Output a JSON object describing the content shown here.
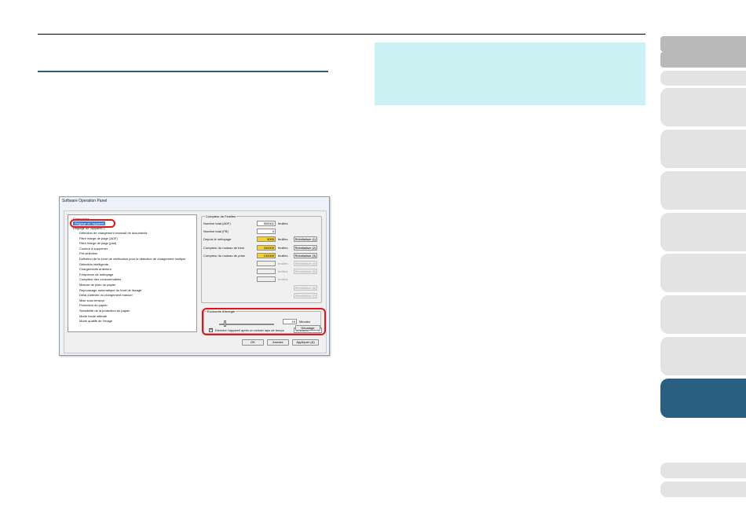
{
  "window": {
    "title": "Software Operation Panel"
  },
  "tree": {
    "items": [
      "Diagnostics",
      "Réglage de l'appareil",
      "Réglage de l'appareil 2",
      "Détection de chargement excessif de documents",
      "Filtre marge de page (ADF)",
      "Filtre marge de page (plat)",
      "Couleur à supprimer",
      "Pré-sélection",
      "Définition de la zone de vérification pour la détection de chargement multiple",
      "Détection intelligente",
      "Chargements antérieur",
      "Fréquence de nettoyage",
      "Compteur des consommables",
      "Mesure de plein du papier",
      "Repoussage automatique du bord de lissage",
      "Délai d'attente du chargement manuel",
      "Mise sous tension",
      "Protection du papier",
      "Sensibilité de la protection du papier",
      "Mode haute altitude",
      "Mode qualité de l'image"
    ],
    "selected_index": 1
  },
  "counters": {
    "group_label": "Compteur de Feuilles",
    "rows": [
      {
        "label": "Nombre total (ADF)",
        "value": "500001",
        "unit": "feuilles",
        "button": "",
        "highlight": false
      },
      {
        "label": "Nombre total (FB)",
        "value": "0",
        "unit": "",
        "button": "",
        "highlight": false
      },
      {
        "label": "Depuis le nettoyage",
        "value": "5000",
        "unit": "feuilles",
        "button": "Réinitialiser (1)",
        "highlight": true
      },
      {
        "label": "Compteur du rouleau de frein",
        "value": "200000",
        "unit": "feuilles",
        "button": "Réinitialiser (2)",
        "highlight": true
      },
      {
        "label": "Compteur du rouleau de prise",
        "value": "100000",
        "unit": "feuilles",
        "button": "Réinitialiser (3)",
        "highlight": true
      },
      {
        "label": "",
        "value": "",
        "unit": "feuilles",
        "button": "Réinitialiser (4)",
        "highlight": false
      },
      {
        "label": "",
        "value": "",
        "unit": "feuilles",
        "button": "Réinitialiser (5)",
        "highlight": false
      },
      {
        "label": "",
        "value": "",
        "unit": "feuilles",
        "button": "",
        "highlight": false
      },
      {
        "label": "",
        "value": "",
        "unit": "",
        "button": "Réinitialiser (6)",
        "highlight": false
      },
      {
        "label": "",
        "value": "",
        "unit": "",
        "button": "Réinitialiser (7)",
        "highlight": false
      }
    ]
  },
  "energy": {
    "group_label": "Economie d'énergie",
    "slider_value": "15",
    "unit": "Minutes",
    "slider_fraction": 0.1,
    "checkbox_label": "Eteindre l'appareil après un certain laps de temps",
    "checkbox_checked": true,
    "dropdown_value": "4 heures",
    "dropdown_arrow": "▾"
  },
  "buttons": {
    "decalage": "Décalage",
    "ok": "OK",
    "cancel": "Annuler",
    "apply": "Appliquer (A)"
  },
  "colors": {
    "highlight_red": "#e0141b",
    "accent_blue": "#2b5f81",
    "note_cyan": "#cbf1f2",
    "counter_yellow": "#f5d130"
  }
}
